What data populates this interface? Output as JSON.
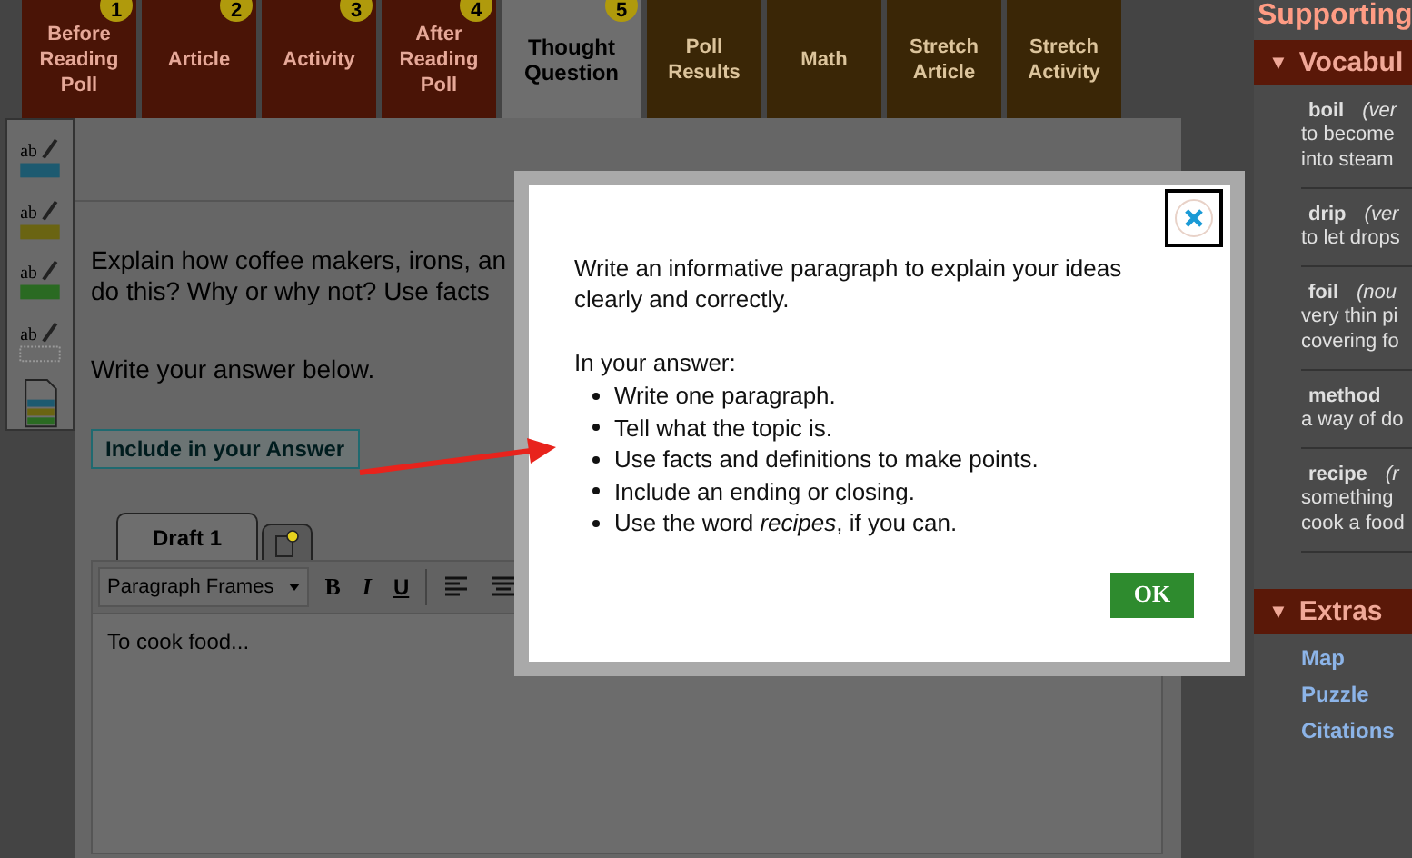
{
  "tabs": [
    {
      "label": "Before Reading Poll",
      "number": "1",
      "selected": false,
      "kind": "lesson"
    },
    {
      "label": "Article",
      "number": "2",
      "selected": false,
      "kind": "lesson"
    },
    {
      "label": "Activity",
      "number": "3",
      "selected": false,
      "kind": "lesson"
    },
    {
      "label": "After Reading Poll",
      "number": "4",
      "selected": false,
      "kind": "lesson"
    },
    {
      "label": "Thought Question",
      "number": "5",
      "selected": true,
      "kind": "lesson"
    },
    {
      "label": "Poll Results",
      "selected": false,
      "kind": "extra"
    },
    {
      "label": "Math",
      "selected": false,
      "kind": "extra"
    },
    {
      "label": "Stretch Article",
      "selected": false,
      "kind": "extra"
    },
    {
      "label": "Stretch Activity",
      "selected": false,
      "kind": "extra"
    }
  ],
  "tools": [
    {
      "kind": "highlighter",
      "label": "ab",
      "color": "#1d5a70"
    },
    {
      "kind": "highlighter",
      "label": "ab",
      "color": "#6a6412"
    },
    {
      "kind": "highlighter",
      "label": "ab",
      "color": "#2a6a22"
    },
    {
      "kind": "clear",
      "label": "ab"
    },
    {
      "kind": "notes"
    }
  ],
  "prompt": {
    "lines": [
      "Explain how coffee makers, irons, an",
      "do this? Why or why not? Use facts"
    ],
    "instruction": "Write your answer below."
  },
  "include_button": "Include in your Answer",
  "editor": {
    "tabs": [
      {
        "kind": "draft",
        "label": "Draft 1",
        "selected": true
      },
      {
        "kind": "note",
        "selected": false
      }
    ],
    "format_select": "Paragraph Frames",
    "buttons": [
      {
        "kind": "bold",
        "label": "B"
      },
      {
        "kind": "italic",
        "label": "I"
      },
      {
        "kind": "underline",
        "label": "U"
      },
      {
        "kind": "align-left"
      },
      {
        "kind": "align-center"
      }
    ],
    "value": "To cook food..."
  },
  "sidebar": {
    "heading": "Supporting",
    "vocabulary": {
      "toggle": "▼",
      "title": "Vocabul",
      "entries": [
        {
          "word": "boil",
          "part": "(ver",
          "definition": [
            "to become",
            "into steam"
          ]
        },
        {
          "word": "drip",
          "part": "(ver",
          "definition": [
            "to let drops"
          ]
        },
        {
          "word": "foil",
          "part": "(nou",
          "definition": [
            "very thin pi",
            "covering fo"
          ]
        },
        {
          "word": "method",
          "definition": [
            "a way of do"
          ]
        },
        {
          "word": "recipe",
          "part": "(r",
          "definition": [
            "something",
            "cook a food"
          ]
        }
      ]
    },
    "extras": {
      "toggle": "▼",
      "title": "Extras",
      "links": [
        "Map",
        "Puzzle",
        "Citations"
      ]
    }
  },
  "dialog": {
    "intro": "Write an informative paragraph to explain your ideas clearly and correctly.",
    "lead": "In your answer:",
    "items": [
      "Write one paragraph.",
      "Tell what the topic is.",
      "Use facts and definitions to make points.",
      "Include an ending or closing.",
      "Use the word *recipes*, if you can."
    ],
    "ok": "OK"
  }
}
